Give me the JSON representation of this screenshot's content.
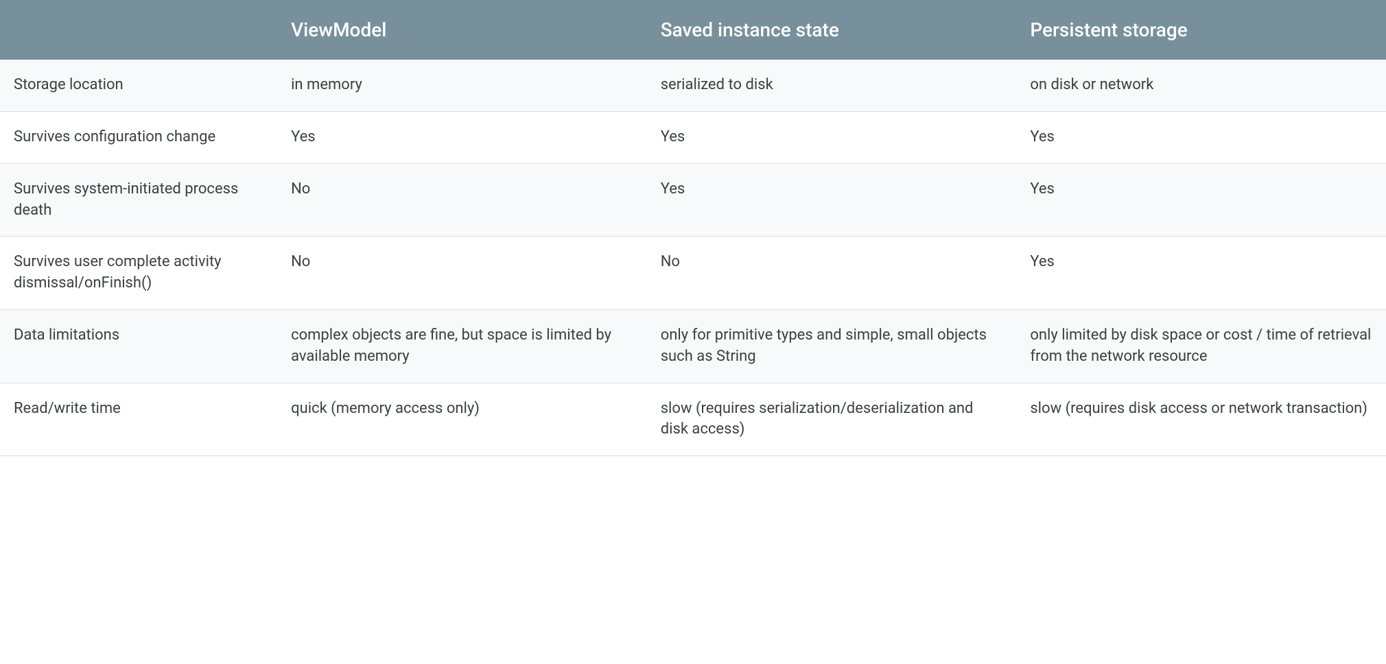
{
  "chart_data": {
    "type": "table",
    "columns": [
      "",
      "ViewModel",
      "Saved instance state",
      "Persistent storage"
    ],
    "rows": [
      {
        "label": "Storage location",
        "values": [
          "in memory",
          "serialized to disk",
          "on disk or network"
        ]
      },
      {
        "label": "Survives configuration change",
        "values": [
          "Yes",
          "Yes",
          "Yes"
        ]
      },
      {
        "label": "Survives system-initiated process death",
        "values": [
          "No",
          "Yes",
          "Yes"
        ]
      },
      {
        "label": "Survives user complete activity dismissal/onFinish()",
        "values": [
          "No",
          "No",
          "Yes"
        ]
      },
      {
        "label": "Data limitations",
        "values": [
          "complex objects are fine, but space is limited by available memory",
          "only for primitive types and simple, small objects such as String",
          "only limited by disk space or cost / time of retrieval from the network resource"
        ]
      },
      {
        "label": "Read/write time",
        "values": [
          "quick (memory access only)",
          "slow (requires serialization/deserialization and disk access)",
          "slow (requires disk access or network transaction)"
        ]
      }
    ]
  }
}
